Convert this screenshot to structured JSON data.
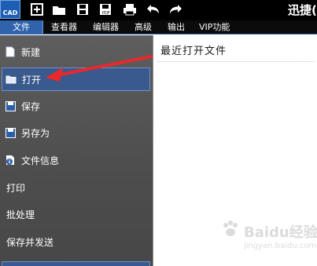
{
  "app": {
    "title": "迅捷("
  },
  "toolbar": {
    "logo_text": "CAD",
    "icons": [
      "new-icon",
      "open-folder-icon",
      "save-icon",
      "save-as-icon",
      "print-icon",
      "undo-icon",
      "redo-icon"
    ]
  },
  "menubar": {
    "items": [
      {
        "label": "文件",
        "active": true
      },
      {
        "label": "查看器"
      },
      {
        "label": "编辑器"
      },
      {
        "label": "高级"
      },
      {
        "label": "输出"
      },
      {
        "label": "VIP功能"
      }
    ]
  },
  "sidebar": {
    "items": [
      {
        "label": "新建",
        "icon": "new-file-icon"
      },
      {
        "label": "打开",
        "icon": "open-folder-icon",
        "active": true
      },
      {
        "label": "保存",
        "icon": "save-icon"
      },
      {
        "label": "另存为",
        "icon": "save-as-icon"
      },
      {
        "label": "文件信息",
        "icon": "file-info-icon"
      },
      {
        "label": "打印"
      },
      {
        "label": "批处理"
      },
      {
        "label": "保存并发送"
      }
    ]
  },
  "main": {
    "recent_title": "最近打开文件"
  },
  "annotation": {
    "arrow_color": "#e8282b"
  },
  "watermark": {
    "text": "Baidu经验",
    "sub": "jingyan.baidu.com"
  },
  "colors": {
    "accent": "#2f64ad",
    "sidebar_active": "#3a5a8e"
  }
}
